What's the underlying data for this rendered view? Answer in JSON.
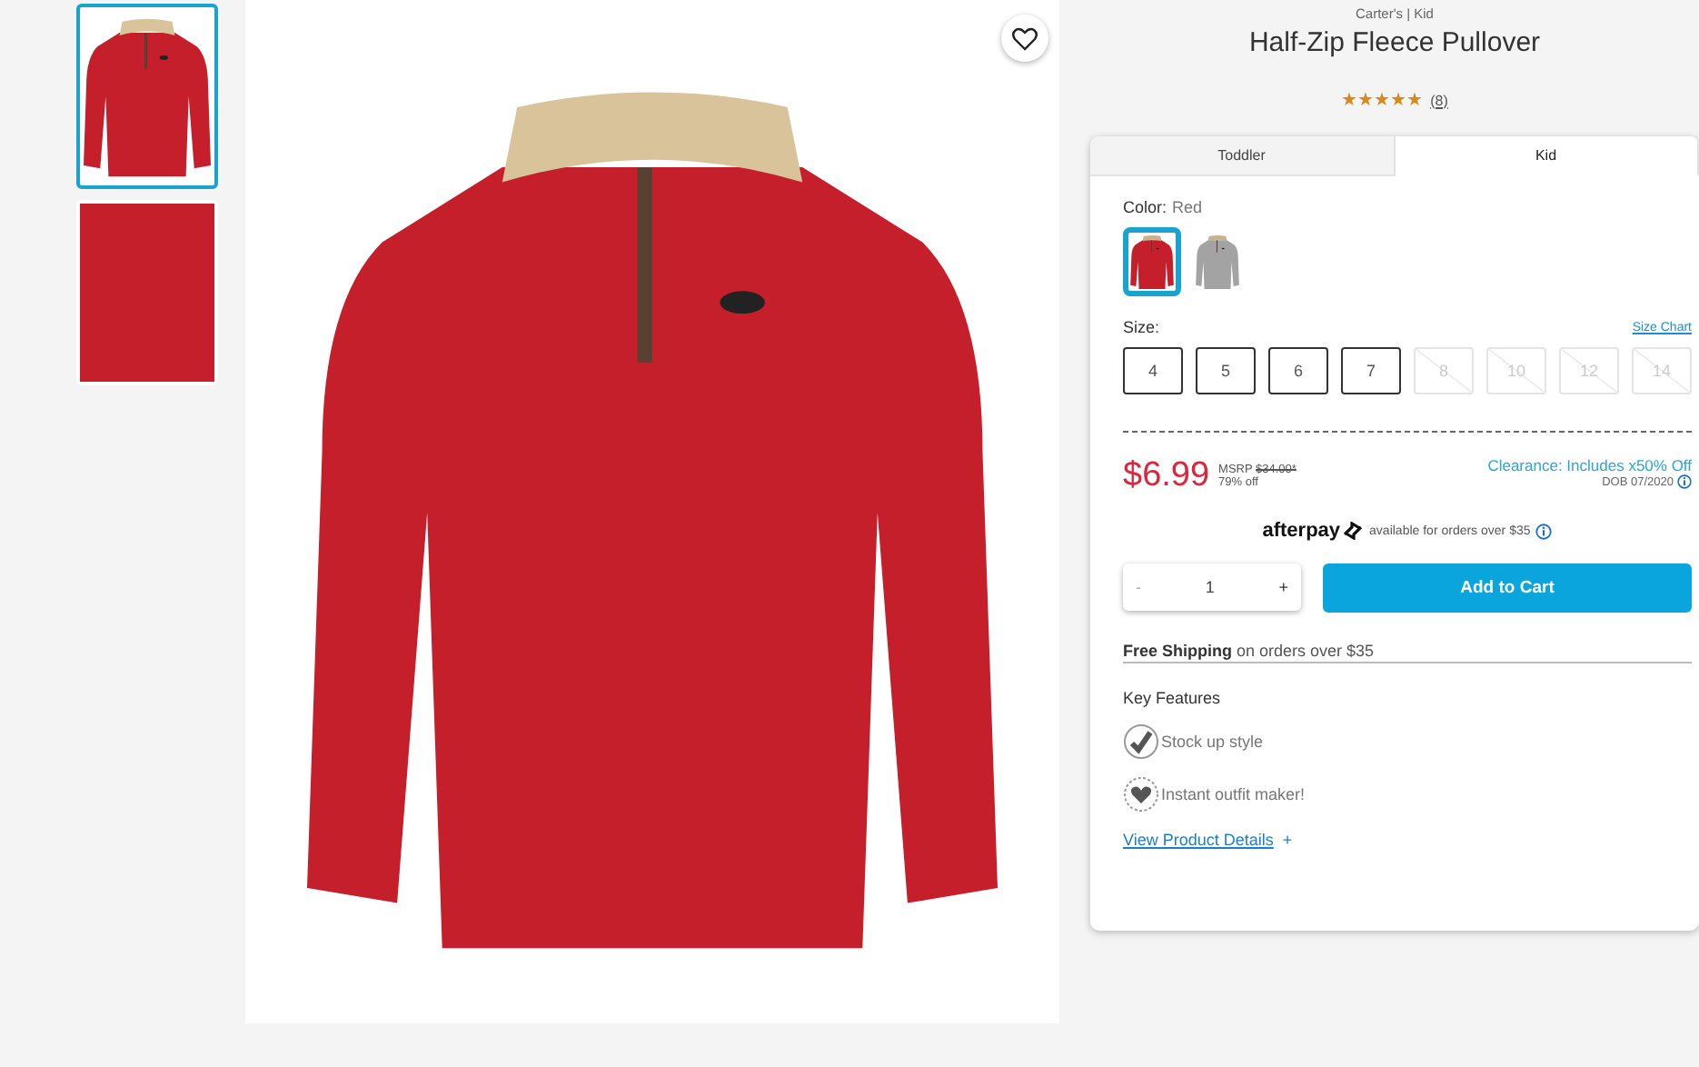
{
  "gallery": {
    "thumbnails": [
      {
        "kind": "full",
        "selected": true
      },
      {
        "kind": "detail",
        "selected": false
      }
    ]
  },
  "product": {
    "breadcrumb": "Carter's | Kid",
    "title": "Half-Zip Fleece Pullover",
    "rating": {
      "stars": 5,
      "count": "(8)"
    }
  },
  "tabs": [
    {
      "label": "Toddler",
      "selected": false
    },
    {
      "label": "Kid",
      "selected": true
    }
  ],
  "color": {
    "label": "Color:",
    "value": "Red",
    "swatches": [
      {
        "color": "#c51f2b",
        "selected": true
      },
      {
        "color": "#a3a3a3",
        "selected": false
      }
    ]
  },
  "size": {
    "label": "Size:",
    "chart_link": "Size Chart",
    "options": [
      {
        "label": "4",
        "available": true
      },
      {
        "label": "5",
        "available": true
      },
      {
        "label": "6",
        "available": true
      },
      {
        "label": "7",
        "available": true
      },
      {
        "label": "8",
        "available": false
      },
      {
        "label": "10",
        "available": false
      },
      {
        "label": "12",
        "available": false
      },
      {
        "label": "14",
        "available": false
      }
    ]
  },
  "price": {
    "sale": "$6.99",
    "msrp_label": "MSRP",
    "msrp": "$34.00*",
    "percent_off": "79% off",
    "clearance": "Clearance: Includes x50% Off",
    "dob": "DOB 07/2020"
  },
  "afterpay": {
    "logo": "afterpay",
    "text": "available for orders over $35"
  },
  "quantity": {
    "minus": "-",
    "value": "1",
    "plus": "+"
  },
  "add_to_cart": "Add to Cart",
  "shipping": "**Free Shipping** on orders over $35",
  "key_features": {
    "title": "Key Features",
    "items": [
      {
        "kind": "check",
        "label": "Stock up style"
      },
      {
        "kind": "heart",
        "label": "Instant outfit maker!"
      }
    ]
  },
  "details_link": {
    "label": "View Product Details",
    "plus": "+"
  }
}
